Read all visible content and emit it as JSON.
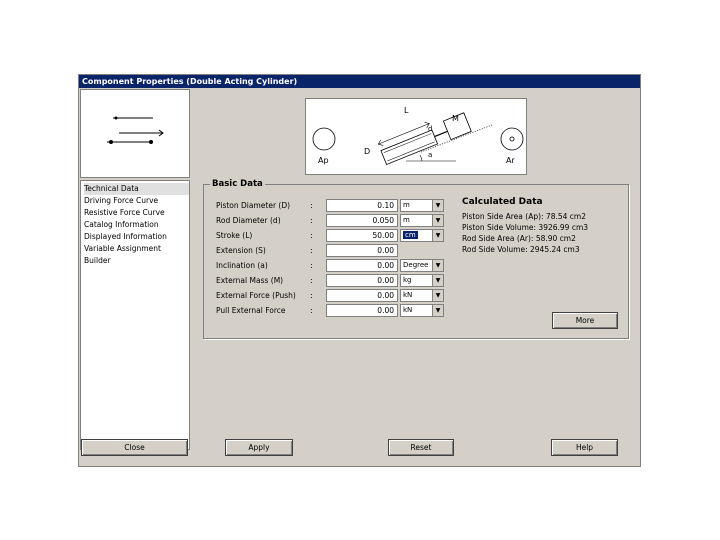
{
  "window": {
    "title": "Component Properties (Double Acting Cylinder)"
  },
  "nav": {
    "items": [
      "Technical Data",
      "Driving Force Curve",
      "Resistive Force Curve",
      "Catalog Information",
      "Displayed Information",
      "Variable Assignment",
      "Builder"
    ]
  },
  "diagram": {
    "labels": {
      "L": "L",
      "M": "M",
      "D": "D",
      "d": "d",
      "a": "a",
      "Ap": "Ap",
      "Ar": "Ar"
    }
  },
  "basic": {
    "title": "Basic Data",
    "rows": [
      {
        "label": "Piston Diameter (D)",
        "colon": ":",
        "value": "0.10",
        "unit": "m"
      },
      {
        "label": "Rod Diameter (d)",
        "colon": ":",
        "value": "0.050",
        "unit": "m"
      },
      {
        "label": "Stroke (L)",
        "colon": ":",
        "value": "50.00",
        "unit": "cm"
      },
      {
        "label": "Extension (S)",
        "colon": ":",
        "value": "0.00",
        "unit": ""
      },
      {
        "label": "Inclination (a)",
        "colon": ":",
        "value": "0.00",
        "unit": "Degree"
      },
      {
        "label": "External Mass (M)",
        "colon": ":",
        "value": "0.00",
        "unit": "kg"
      },
      {
        "label": "External Force (Push)",
        "colon": ":",
        "value": "0.00",
        "unit": "kN"
      },
      {
        "label": "Pull External Force",
        "colon": ":",
        "value": "0.00",
        "unit": "kN"
      }
    ]
  },
  "calculated": {
    "title": "Calculated Data",
    "lines": [
      "Piston Side Area (Ap): 78.54 cm2",
      "Piston Side Volume: 3926.99 cm3",
      "Rod Side Area (Ar): 58.90 cm2",
      "Rod Side Volume: 2945.24 cm3"
    ]
  },
  "buttons": {
    "more": "More",
    "close": "Close",
    "apply": "Apply",
    "reset": "Reset",
    "help": "Help"
  }
}
